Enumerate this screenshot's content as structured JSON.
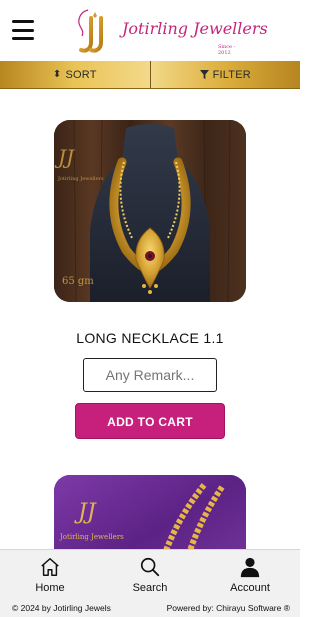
{
  "header": {
    "menu_icon": "hamburger-menu-icon",
    "brand_name": "Jotirling Jewellers",
    "brand_since": "Since - 2012",
    "brand_color": "#c2257a"
  },
  "toolbar": {
    "sort_label": "SORT",
    "filter_label": "FILTER",
    "gradient_gold": "#e9c456"
  },
  "products": [
    {
      "title": "LONG NECKLACE 1.1",
      "image_weight_text": "65 gm",
      "image_watermark": "Jotirling Jewellers",
      "remark_placeholder": "Any Remark...",
      "add_to_cart_label": "ADD TO CART"
    },
    {
      "image_watermark": "Jotirling Jewellers"
    }
  ],
  "bottom_nav": {
    "items": [
      {
        "label": "Home",
        "icon": "home-icon"
      },
      {
        "label": "Search",
        "icon": "search-icon"
      },
      {
        "label": "Account",
        "icon": "account-icon"
      }
    ]
  },
  "footer": {
    "copyright": "© 2024 by Jotirling Jewels",
    "powered_by": "Powered by: Chirayu Software ®"
  },
  "colors": {
    "accent": "#c71f7c",
    "gold": "#d9ad3c"
  }
}
